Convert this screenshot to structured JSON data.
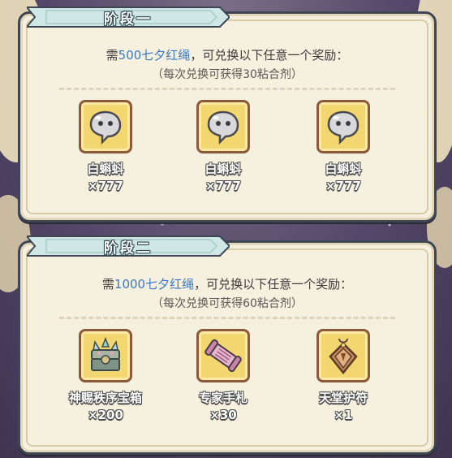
{
  "colors": {
    "panel_bg": "#f6f0df",
    "ribbon": "#cfe8e6",
    "highlight_amount": "#3d79c2",
    "icon_frame": "#f2d66f"
  },
  "stages": [
    {
      "title": "阶段一",
      "requirement_prefix": "需",
      "requirement_amount": "500七夕红绳",
      "requirement_suffix": "，可兑换以下任意一个奖励：",
      "note": "（每次兑换可获得30粘合剂）",
      "rewards": [
        {
          "name": "白蝌蚪",
          "qty": "×777",
          "icon": "white-tadpole-icon"
        },
        {
          "name": "白蝌蚪",
          "qty": "×777",
          "icon": "white-tadpole-icon"
        },
        {
          "name": "白蝌蚪",
          "qty": "×777",
          "icon": "white-tadpole-icon"
        }
      ]
    },
    {
      "title": "阶段二",
      "requirement_prefix": "需",
      "requirement_amount": "1000七夕红绳",
      "requirement_suffix": "，可兑换以下任意一个奖励：",
      "note": "（每次兑换可获得60粘合剂）",
      "rewards": [
        {
          "name": "神赐秩序宝箱",
          "qty": "×200",
          "icon": "treasure-chest-icon"
        },
        {
          "name": "专家手札",
          "qty": "×30",
          "icon": "scroll-icon"
        },
        {
          "name": "天堂护符",
          "qty": "×1",
          "icon": "amulet-icon"
        }
      ]
    }
  ]
}
